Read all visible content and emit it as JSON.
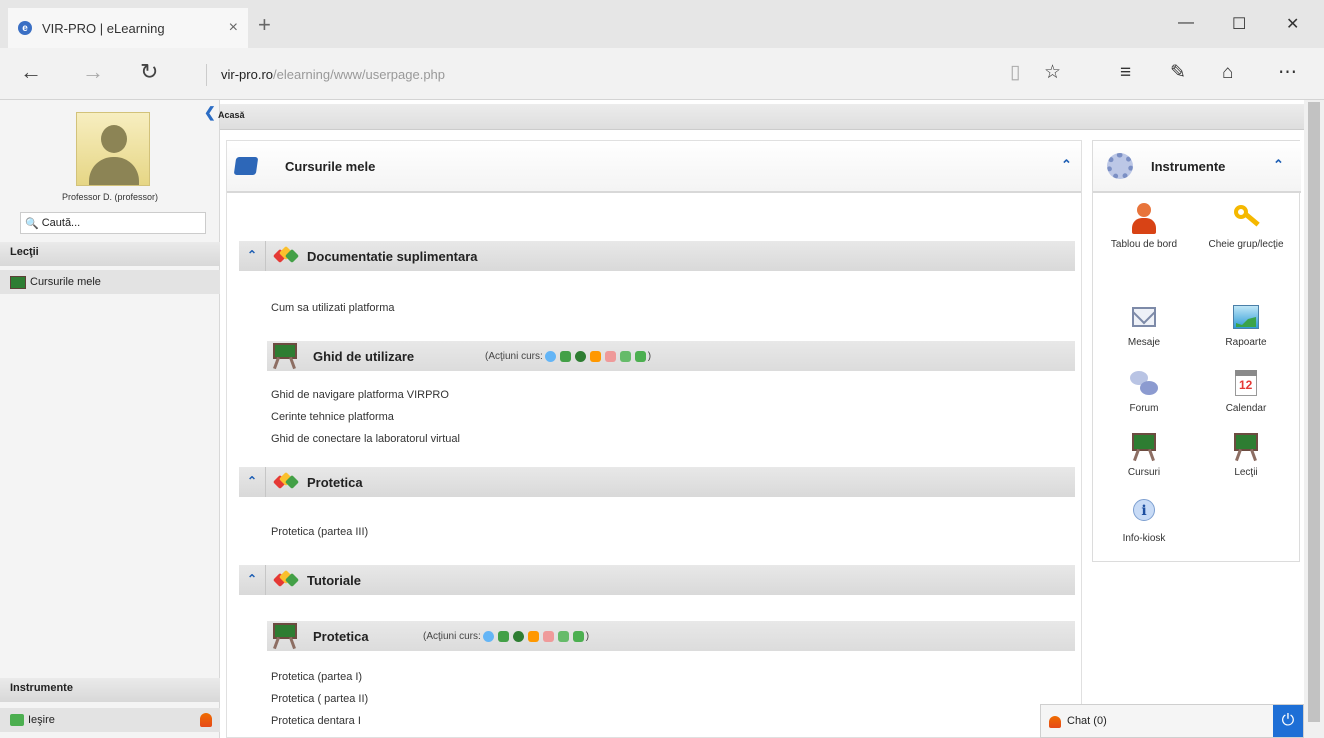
{
  "browser": {
    "tab_title": "VIR-PRO | eLearning",
    "tab_close": "×",
    "new_tab": "+",
    "url_host": "vir-pro.ro",
    "url_path": "/elearning/www/userpage.php",
    "minimize": "—",
    "maximize": "☐",
    "close": "✕"
  },
  "breadcrumb": {
    "home": "Acasă"
  },
  "profile": {
    "name": "Professor D. (professor)"
  },
  "search": {
    "placeholder": "Caută..."
  },
  "sidebar": {
    "section_lessons": "Lecţii",
    "my_courses": "Cursurile mele",
    "section_tools": "Instrumente",
    "exit": "Ieşire"
  },
  "main": {
    "title": "Cursurile mele",
    "categories": [
      {
        "title": "Documentatie suplimentara",
        "items": [
          "Cum sa utilizati platforma"
        ],
        "course": {
          "title": "Ghid de utilizare",
          "actions_label": "(Acţiuni curs:",
          "actions_end": ")",
          "lessons": [
            "Ghid de navigare platforma VIRPRO",
            "Cerinte tehnice platforma",
            "Ghid de conectare la laboratorul virtual"
          ]
        }
      },
      {
        "title": "Protetica",
        "items": [
          "Protetica (partea III)"
        ]
      },
      {
        "title": "Tutoriale",
        "course": {
          "title": "Protetica",
          "actions_label": "(Acţiuni curs:",
          "actions_end": ")",
          "lessons": [
            "Protetica (partea I)",
            "Protetica ( partea II)",
            "Protetica dentara I"
          ]
        }
      }
    ]
  },
  "tools": {
    "title": "Instrumente",
    "items": [
      {
        "label": "Tablou de bord",
        "icon": "user-dashboard-icon"
      },
      {
        "label": "Cheie grup/lecţie",
        "icon": "key-icon"
      },
      {
        "label": "Mesaje",
        "icon": "envelope-icon"
      },
      {
        "label": "Rapoarte",
        "icon": "chart-icon"
      },
      {
        "label": "Forum",
        "icon": "speech-bubbles-icon"
      },
      {
        "label": "Calendar",
        "icon": "calendar-icon"
      },
      {
        "label": "Cursuri",
        "icon": "chalkboard-icon"
      },
      {
        "label": "Lecţii",
        "icon": "chalkboard-icon"
      },
      {
        "label": "Info-kiosk",
        "icon": "info-icon"
      }
    ],
    "calendar_day": "12",
    "info_glyph": "i"
  },
  "chat": {
    "label": "Chat (0)"
  }
}
